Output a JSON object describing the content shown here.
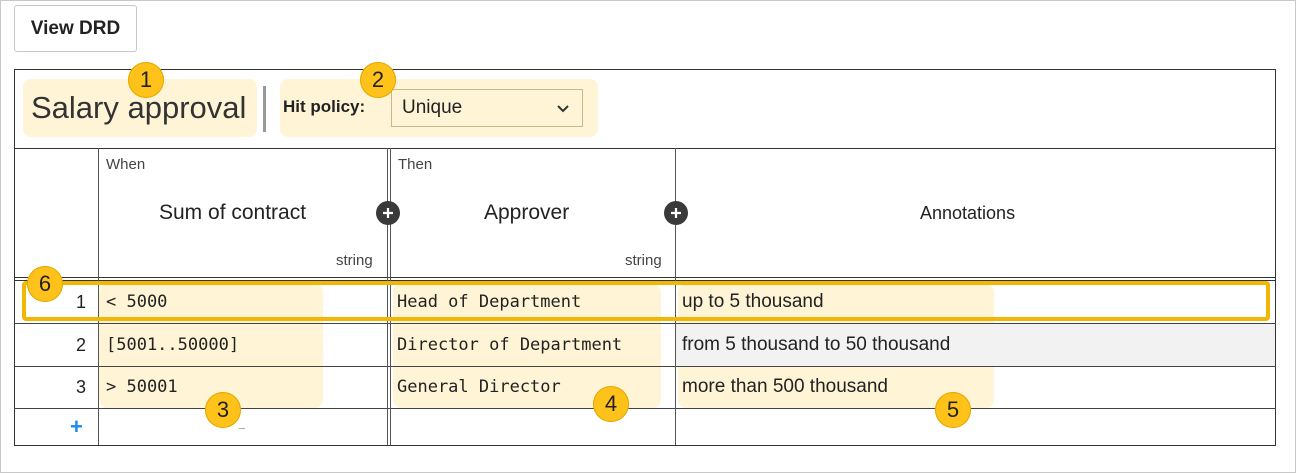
{
  "toolbar": {
    "view_drd_label": "View DRD"
  },
  "table": {
    "name": "Salary approval",
    "hit_policy_label": "Hit policy:",
    "hit_policy_value": "Unique",
    "input_section_label": "When",
    "output_section_label": "Then",
    "columns": [
      {
        "label": "Sum of contract",
        "type": "string"
      },
      {
        "label": "Approver",
        "type": "string"
      },
      {
        "label": "Annotations"
      }
    ],
    "rows": [
      {
        "num": "1",
        "input": "< 5000",
        "output": "Head of Department",
        "annotation": "up to 5 thousand"
      },
      {
        "num": "2",
        "input": "[5001..50000]",
        "output": "Director of Department",
        "annotation": "from 5 thousand to 50 thousand"
      },
      {
        "num": "3",
        "input": "> 50001",
        "output": "General Director",
        "annotation": "more than 500 thousand"
      }
    ],
    "add_row_glyph": "+"
  },
  "callouts": [
    "1",
    "2",
    "3",
    "4",
    "5",
    "6"
  ],
  "colors": {
    "callout_fill": "#ffc21a",
    "highlight": "#ffde78",
    "row_outline": "#f2b705",
    "add_link": "#1e88e5"
  },
  "icons": [
    "chevron-down-icon",
    "plus-icon"
  ]
}
